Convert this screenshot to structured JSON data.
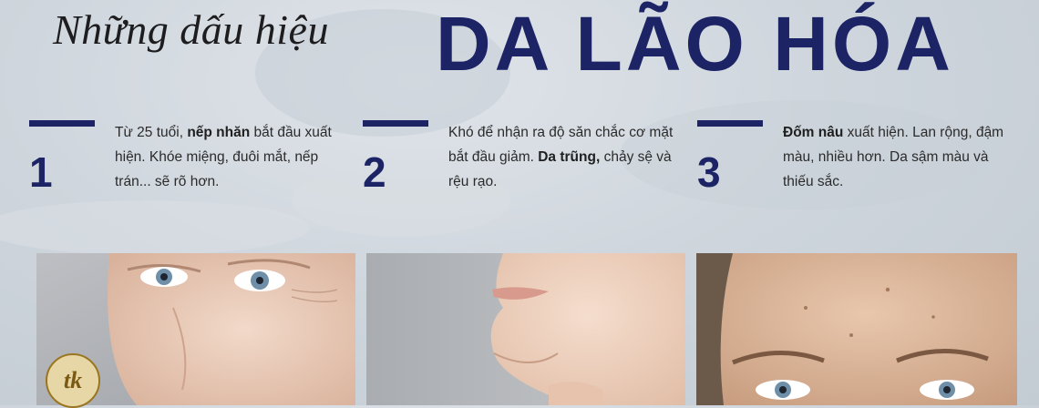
{
  "header": {
    "subtitle": "Những dấu hiệu",
    "headline": "DA LÃO HÓA"
  },
  "signs": [
    {
      "number": "1",
      "text_before": "Từ 25 tuổi, ",
      "bold_1": "nếp nhăn",
      "text_middle": " bắt đầu xuất hiện. Khóe miệng, đuôi mắt, nếp trán... sẽ rõ hơn.",
      "bold_2": "",
      "text_after": ""
    },
    {
      "number": "2",
      "text_before": "Khó để nhận ra độ săn chắc cơ mặt bắt đầu giảm. ",
      "bold_1": "Da trũng,",
      "text_middle": " chảy sệ và rệu rạo.",
      "bold_2": "",
      "text_after": ""
    },
    {
      "number": "3",
      "text_before": "",
      "bold_1": "Đốm nâu",
      "text_middle": " xuất hiện. Lan rộng, đậm màu, nhiều hơn. Da sậm màu và thiếu sắc.",
      "bold_2": "",
      "text_after": ""
    }
  ],
  "logo": {
    "text": "tk"
  },
  "colors": {
    "navy": "#1c2466",
    "background": "#d3d9df"
  }
}
